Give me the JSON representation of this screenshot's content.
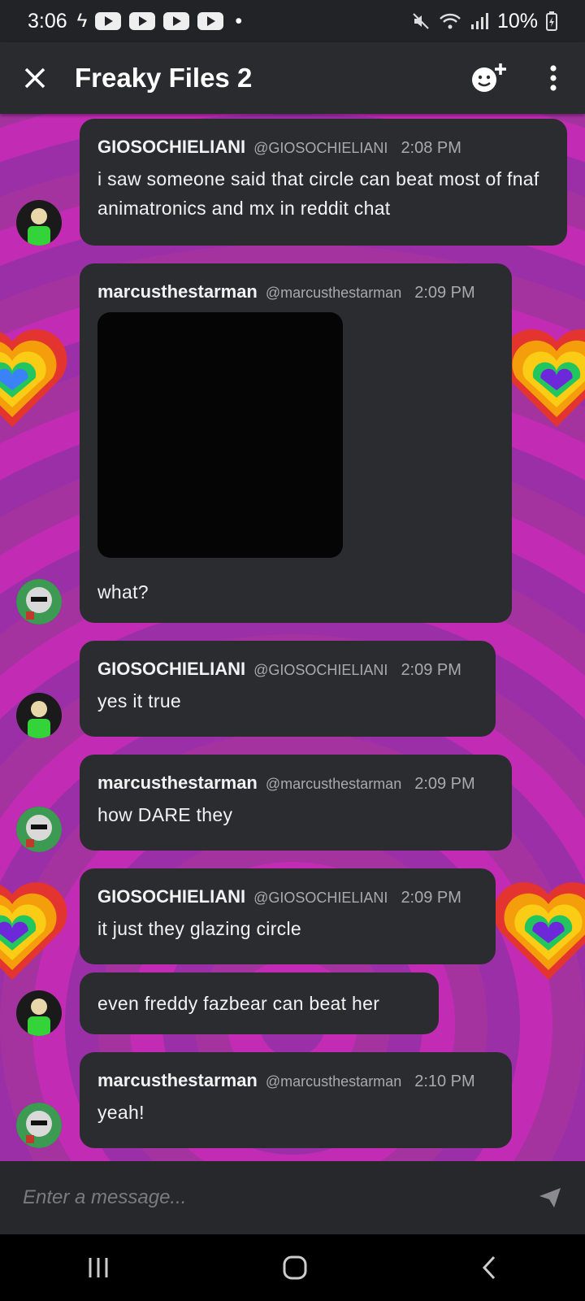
{
  "status_bar": {
    "time": "3:06",
    "battery": "10%"
  },
  "header": {
    "title": "Freaky Files 2"
  },
  "messages": [
    {
      "user": "GIOSOCHIELIANI",
      "handle": "@GIOSOCHIELIANI",
      "time": "2:08 PM",
      "text": "i saw someone said that circle can beat most of fnaf animatronics and mx in reddit chat"
    },
    {
      "user": "marcusthestarman",
      "handle": "@marcusthestarman",
      "time": "2:09 PM",
      "text": "what?"
    },
    {
      "user": "GIOSOCHIELIANI",
      "handle": "@GIOSOCHIELIANI",
      "time": "2:09 PM",
      "text": "yes it true"
    },
    {
      "user": "marcusthestarman",
      "handle": "@marcusthestarman",
      "time": "2:09 PM",
      "text": "how DARE they"
    },
    {
      "user": "GIOSOCHIELIANI",
      "handle": "@GIOSOCHIELIANI",
      "time": "2:09 PM",
      "text": "it just they glazing circle"
    },
    {
      "text": "even freddy fazbear can beat her"
    },
    {
      "user": "marcusthestarman",
      "handle": "@marcusthestarman",
      "time": "2:10 PM",
      "text": "yeah!"
    }
  ],
  "input": {
    "placeholder": "Enter a message..."
  },
  "colors": {
    "background_pink": "#a52fa6",
    "bubble": "#2b2c30",
    "header": "#2a2b2f"
  }
}
